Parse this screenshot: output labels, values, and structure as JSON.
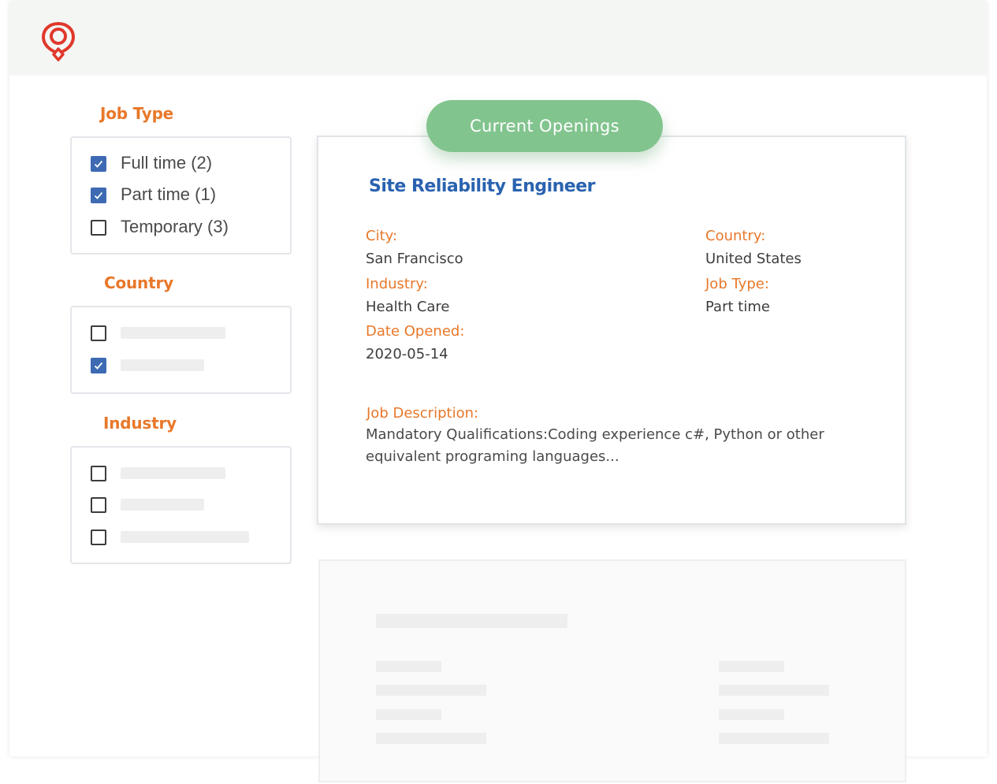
{
  "brand": {
    "logo": "map-pin-logo",
    "accent": "#e0382b"
  },
  "filters": {
    "job_type": {
      "title": "Job Type",
      "options": [
        {
          "label": "Full time (2)",
          "checked": true
        },
        {
          "label": "Part time (1)",
          "checked": true
        },
        {
          "label": "Temporary (3)",
          "checked": false
        }
      ]
    },
    "country": {
      "title": "Country",
      "options": [
        {
          "checked": false
        },
        {
          "checked": true
        }
      ]
    },
    "industry": {
      "title": "Industry",
      "options": [
        {
          "checked": false
        },
        {
          "checked": false
        },
        {
          "checked": false
        }
      ]
    }
  },
  "openings": {
    "heading": "Current Openings",
    "job": {
      "title": "Site Reliability Engineer",
      "city_label": "City:",
      "city": "San Francisco",
      "country_label": "Country:",
      "country": "United States",
      "industry_label": "Industry:",
      "industry": "Health Care",
      "job_type_label": "Job Type:",
      "job_type": "Part time",
      "date_label": "Date Opened:",
      "date": "2020-05-14",
      "description_label": "Job Description:",
      "description": "Mandatory Qualifications:Coding experience c#, Python or other equivalent programing languages..."
    }
  },
  "colors": {
    "label": "#e8782a",
    "title": "#2a62b0",
    "checkbox": "#3d6ab3",
    "pill": "#82c48e"
  }
}
